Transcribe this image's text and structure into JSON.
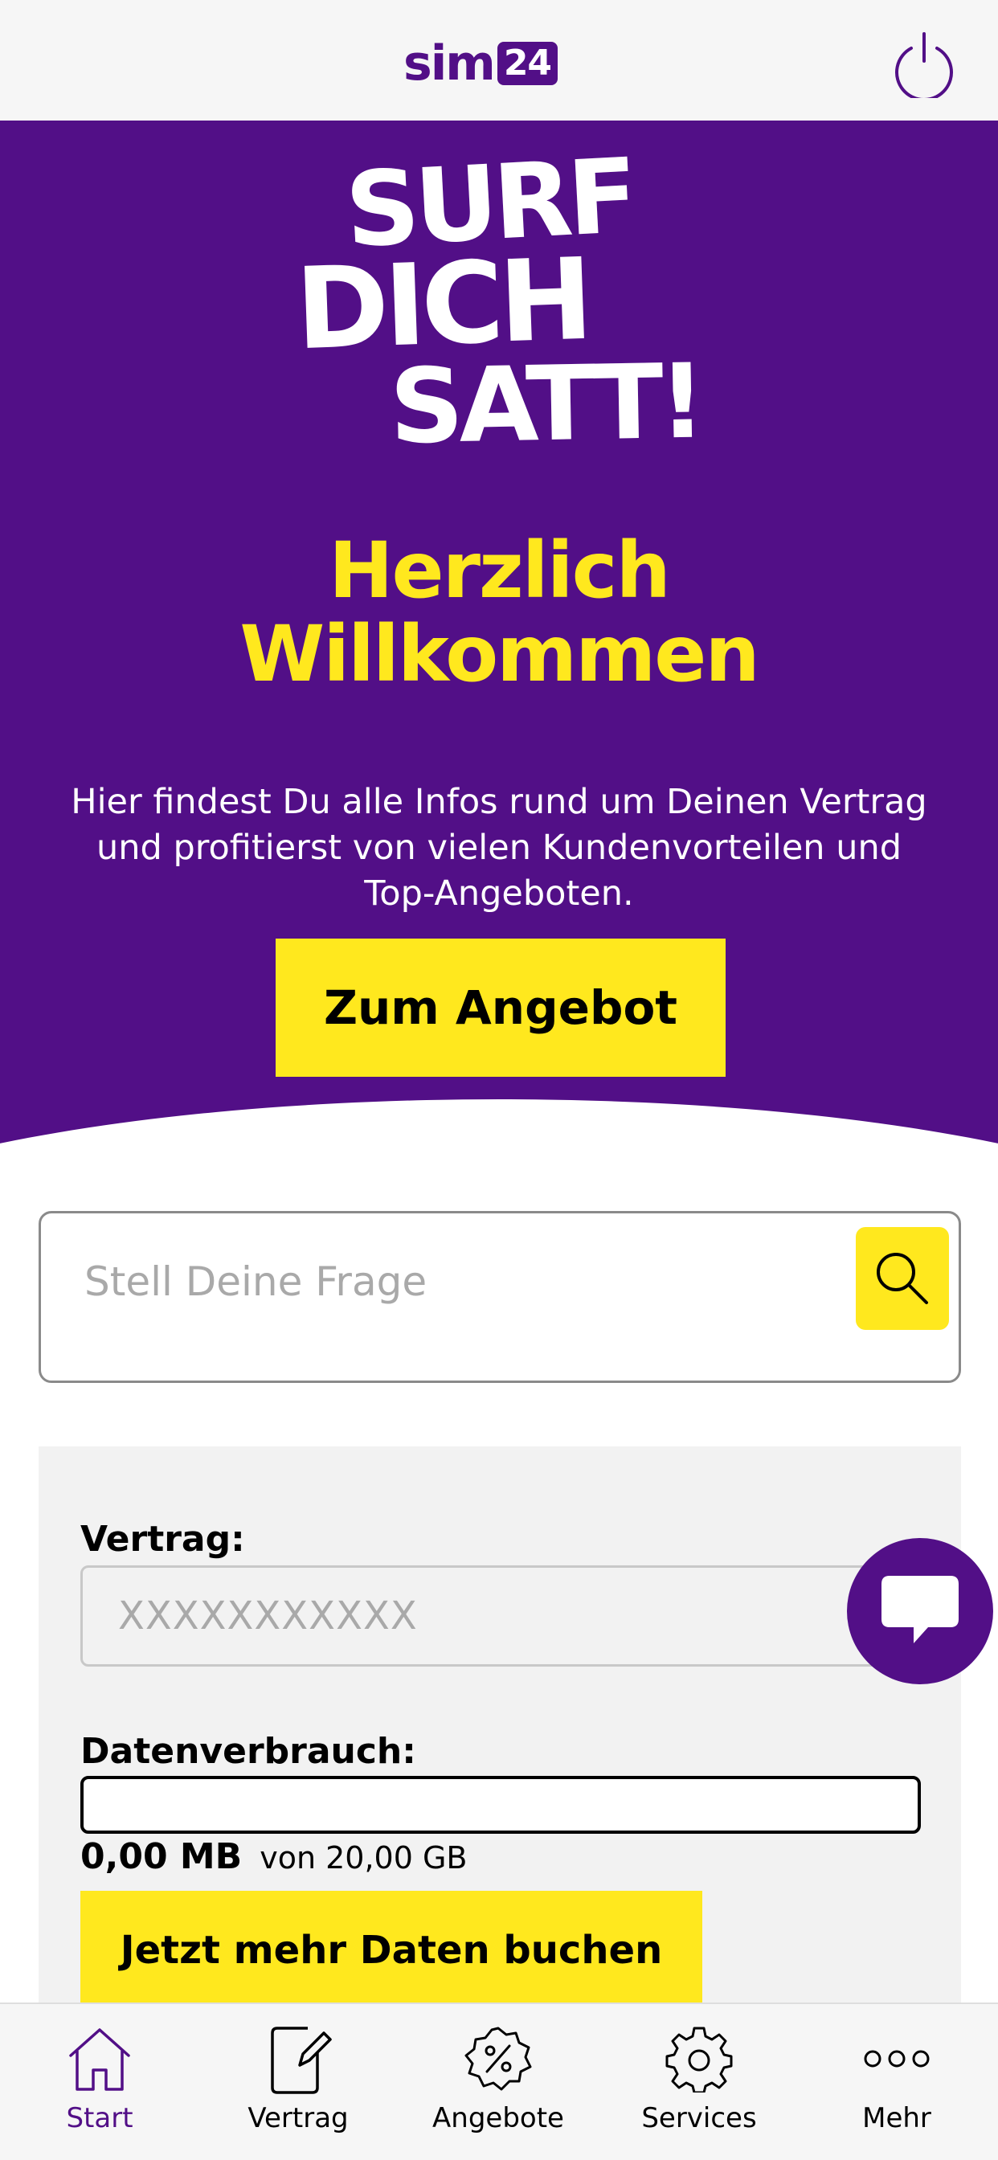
{
  "header": {
    "logo_text": "sim",
    "logo_badge": "24",
    "logout_icon": "power-icon"
  },
  "hero": {
    "slogan_line1": "SURF",
    "slogan_line2": "DICH",
    "slogan_line3": "SATT!",
    "welcome_line1": "Herzlich",
    "welcome_line2": "Willkommen",
    "intro_line1": "Hier findest Du alle Infos rund um Deinen Vertrag",
    "intro_line2": "und profitierst von vielen Kundenvorteilen und",
    "intro_line3": "Top-Angeboten.",
    "cta_label": "Zum Angebot"
  },
  "search": {
    "placeholder": "Stell Deine Frage",
    "icon": "search-icon"
  },
  "contract": {
    "vertrag_label": "Vertrag:",
    "vertrag_value": "XXXXXXXXXXX",
    "data_label": "Datenverbrauch:",
    "data_used": "0,00 MB",
    "data_total": "von 20,00 GB",
    "data_used_fraction": 0,
    "more_data_label": "Jetzt mehr Daten buchen"
  },
  "chat": {
    "icon": "chat-bubble-icon"
  },
  "nav": {
    "items": [
      {
        "label": "Start",
        "icon": "home-icon",
        "active": true
      },
      {
        "label": "Vertrag",
        "icon": "contract-edit-icon",
        "active": false
      },
      {
        "label": "Angebote",
        "icon": "percent-badge-icon",
        "active": false
      },
      {
        "label": "Services",
        "icon": "gear-icon",
        "active": false
      },
      {
        "label": "Mehr",
        "icon": "more-dots-icon",
        "active": false
      }
    ]
  },
  "colors": {
    "brand_purple": "#520f87",
    "accent_yellow": "#ffe81e",
    "background": "#ffffff",
    "card_background": "#f2f2f2"
  }
}
